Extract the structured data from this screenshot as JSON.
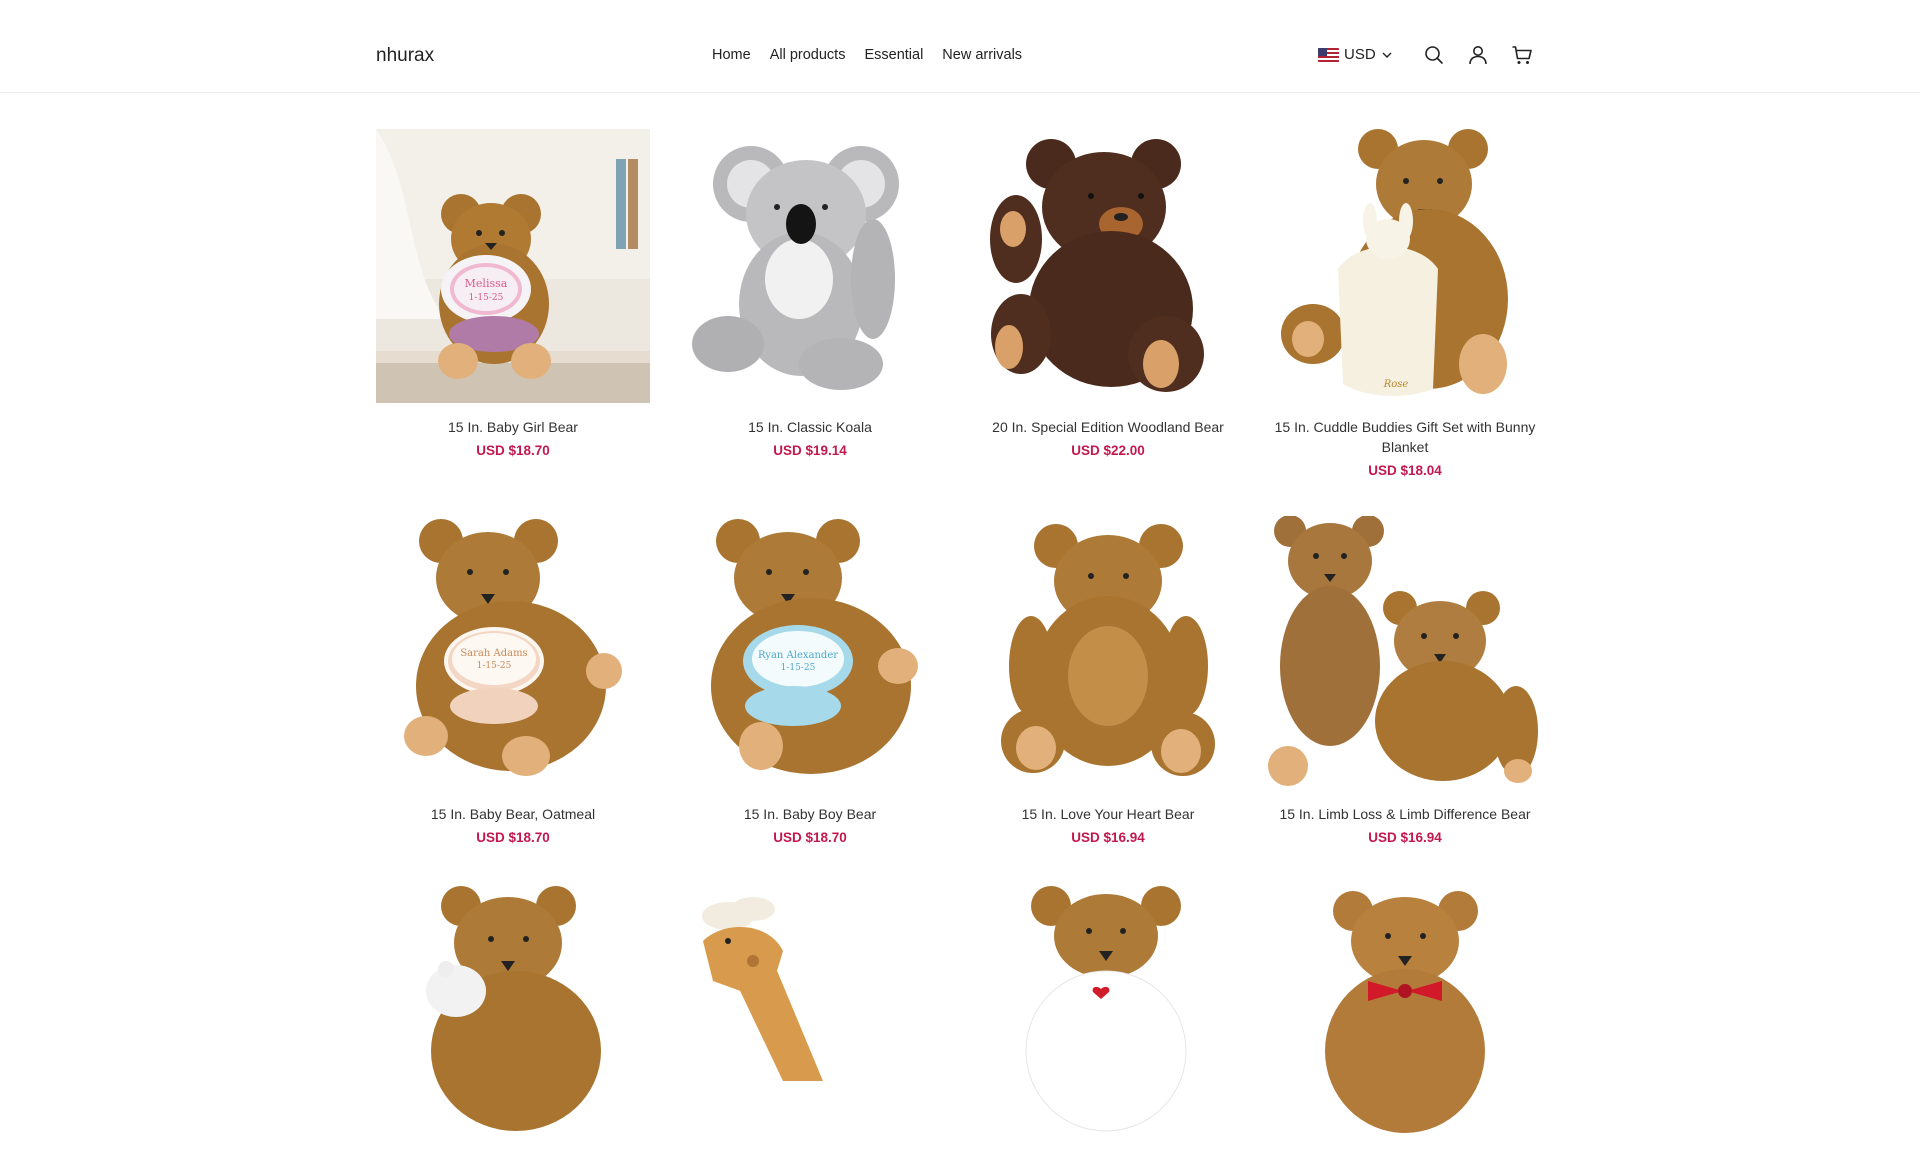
{
  "header": {
    "logo": "nhurax",
    "nav": [
      {
        "label": "Home"
      },
      {
        "label": "All products"
      },
      {
        "label": "Essential"
      },
      {
        "label": "New arrivals"
      }
    ],
    "currency": "USD",
    "icons": [
      "search-icon",
      "account-icon",
      "cart-icon"
    ]
  },
  "products": [
    {
      "name": "15 In. Baby Girl Bear",
      "price": "USD $18.70",
      "bib_text": "Melissa\n1-15-25",
      "image": "brown-bear-pink-bib"
    },
    {
      "name": "15 In. Classic Koala",
      "price": "USD $19.14",
      "image": "gray-koala"
    },
    {
      "name": "20 In. Special Edition Woodland Bear",
      "price": "USD $22.00",
      "image": "dark-brown-bear"
    },
    {
      "name": "15 In. Cuddle Buddies Gift Set with Bunny Blanket",
      "price": "USD $18.04",
      "blanket_text": "Rose",
      "image": "bear-bunny-blanket"
    },
    {
      "name": "15 In. Baby Bear, Oatmeal",
      "price": "USD $18.70",
      "bib_text": "Sarah Adams\n1-15-25",
      "image": "bear-oatmeal-bib"
    },
    {
      "name": "15 In. Baby Boy Bear",
      "price": "USD $18.70",
      "bib_text": "Ryan Alexander\n1-15-25",
      "image": "bear-blue-bib"
    },
    {
      "name": "15 In. Love Your Heart Bear",
      "price": "USD $16.94",
      "image": "brown-bear"
    },
    {
      "name": "15 In. Limb Loss & Limb Difference Bear",
      "price": "USD $16.94",
      "image": "two-bears"
    },
    {
      "name": "",
      "price": "",
      "image": "bear-with-cat"
    },
    {
      "name": "",
      "price": "",
      "image": "giraffe"
    },
    {
      "name": "",
      "price": "",
      "image": "bear-white-shirt"
    },
    {
      "name": "",
      "price": "",
      "image": "bear-red-bowtie"
    }
  ],
  "colors": {
    "price": "#c3184f",
    "bear_golden": "#a8742f",
    "bear_dark": "#4a2a1c",
    "koala_gray": "#b9b9bb"
  }
}
